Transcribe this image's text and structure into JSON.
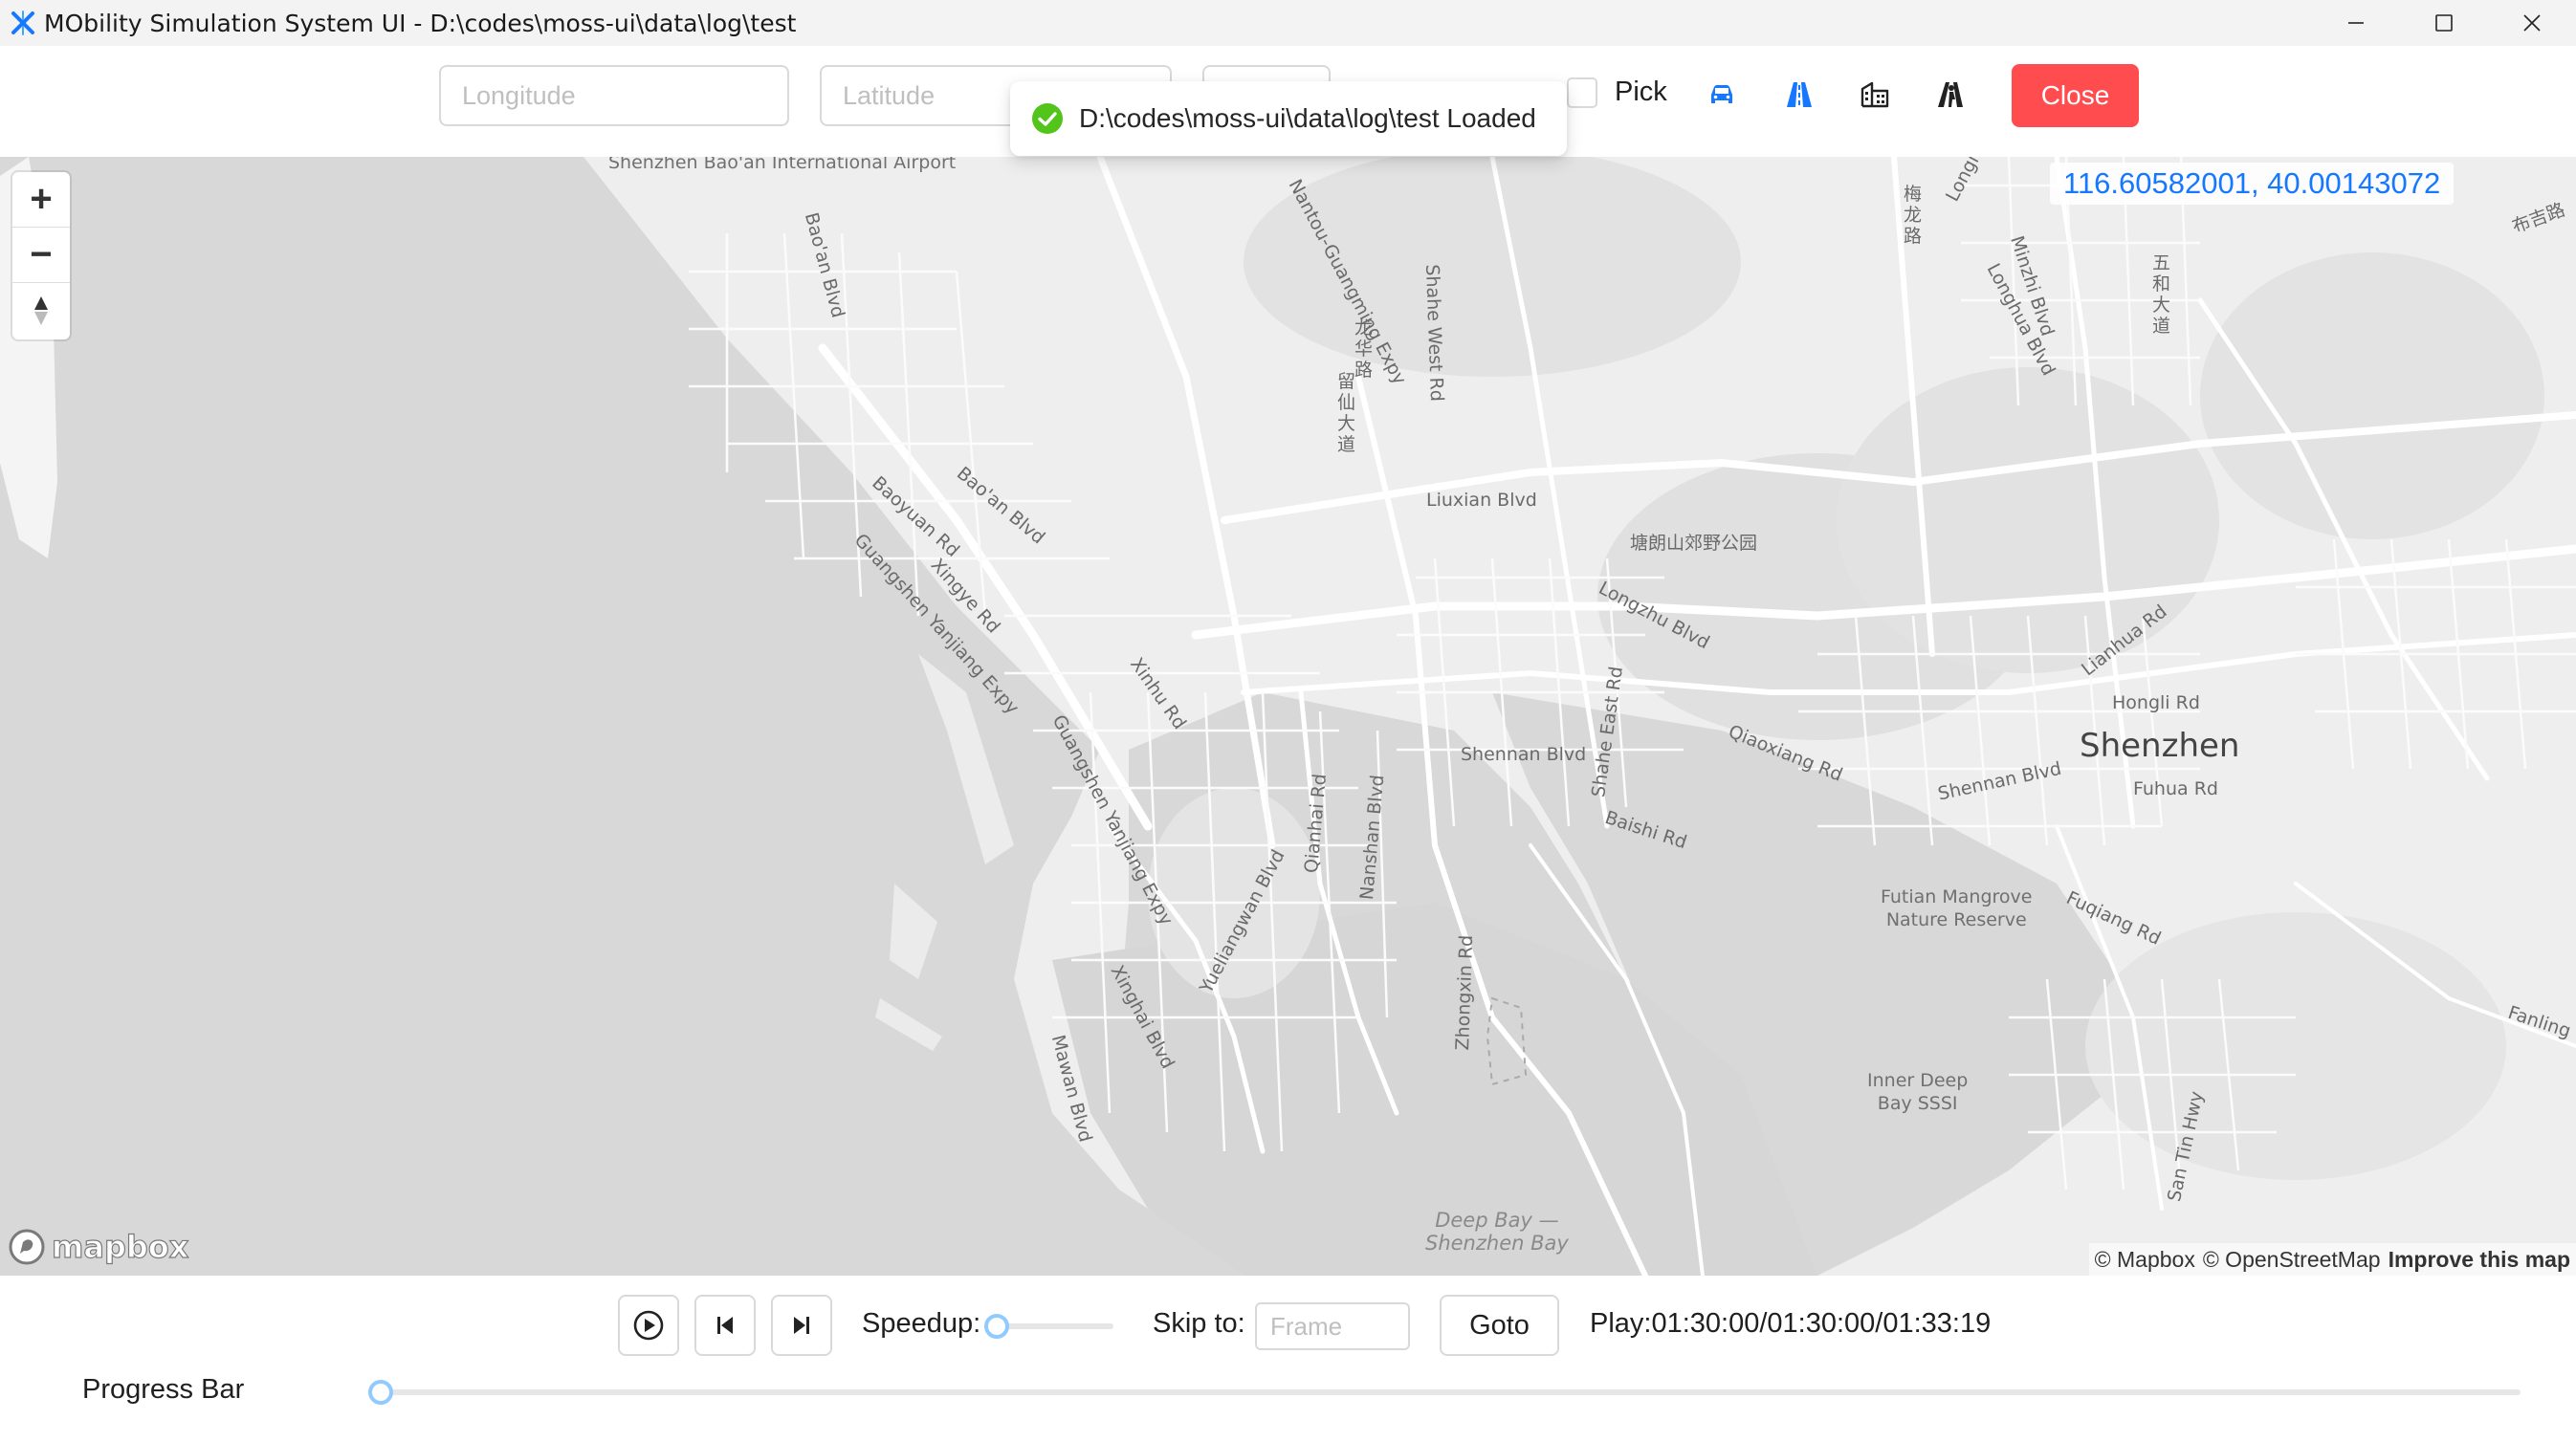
{
  "window": {
    "title": "MObility Simulation System UI - D:\\codes\\moss-ui\\data\\log\\test",
    "controls": [
      "minimize-icon",
      "maximize-icon",
      "close-icon"
    ]
  },
  "toolbar": {
    "longitude_placeholder": "Longitude",
    "latitude_placeholder": "Latitude",
    "pick_label": "Pick",
    "layer_icons": [
      "car-icon",
      "road-icon",
      "building-icon",
      "pedestrian-road-icon"
    ],
    "close_label": "Close",
    "colors": {
      "accent": "#1677ff",
      "danger": "#ff4d4f"
    }
  },
  "toast": {
    "message": "D:\\codes\\moss-ui\\data\\log\\test Loaded",
    "icon": "check-circle-icon",
    "color": "#52c41a"
  },
  "map": {
    "coordinates": "116.60582001, 40.00143072",
    "zoom_controls": [
      "zoom-in-icon",
      "zoom-out-icon",
      "compass-icon"
    ],
    "logo": "mapbox",
    "attribution": {
      "mapbox": "© Mapbox",
      "osm": "© OpenStreetMap",
      "improve": "Improve this map"
    },
    "labels": {
      "airport": "Shenzhen Bao'an International Airport",
      "bao_an_blvd_1": "Bao'an Blvd",
      "bao_an_blvd_2": "Bao'an Blvd",
      "baoyuan": "Baoyuan Rd",
      "guangshen_1": "Guangshen Yanjiang Expy",
      "guangshen_2": "Guangshen Yanjiang Expy",
      "xingye": "Xingye Rd",
      "xinhu": "Xinhu Rd",
      "nantou": "Nantou-Guangming Expy",
      "shahe_west": "Shahe West Rd",
      "liuxian": "Liuxian Blvd",
      "tangming_park": "塘朗山郊野公园",
      "longzhu": "Longzhu Blvd",
      "qiaoxiang": "Qiaoxiang Rd",
      "shennan_1": "Shennan Blvd",
      "shennan_2": "Shennan Blvd",
      "shahe_east": "Shahe East Rd",
      "baishi": "Baishi Rd",
      "qianhai": "Qianhai Rd",
      "nanshan": "Nanshan Blvd",
      "yueliangwan": "Yueliangwan Blvd",
      "xinghai": "Xinghai Blvd",
      "mawan": "Mawan Blvd",
      "zhongxin": "Zhongxin Rd",
      "deep_bay": "Deep Bay —\nShenzhen Bay",
      "futian_mangrove": "Futian Mangrove\nNature Reserve",
      "inner_deep_bay": "Inner Deep\nBay SSSI",
      "shenzhen": "Shenzhen",
      "lianhua": "Lianhua Rd",
      "hongli": "Hongli Rd",
      "fuhua": "Fuhua Rd",
      "fuqiang": "Fuqiang Rd",
      "fanling": "Fanling",
      "san_tin": "San Tin Hwy",
      "minzhi": "Minzhi Blvd",
      "longhua": "Longhua Blvd",
      "longi": "Longi",
      "meilong_cn": "梅龙路",
      "wuhe_cn": "五和大道",
      "buji_cn": "布吉路",
      "longhua_cn": "龙华路",
      "liuxian_cn": "留仙大道"
    }
  },
  "controls": {
    "play_icon": "play-icon",
    "prev_icon": "step-backward-icon",
    "next_icon": "step-forward-icon",
    "speedup_label": "Speedup:",
    "speedup_value": 0,
    "skip_label": "Skip to:",
    "frame_placeholder": "Frame",
    "goto_label": "Goto",
    "play_status": "Play:01:30:00/01:30:00/01:33:19",
    "progress_label": "Progress Bar",
    "progress_value": 0,
    "slider_color": "#91caff"
  }
}
